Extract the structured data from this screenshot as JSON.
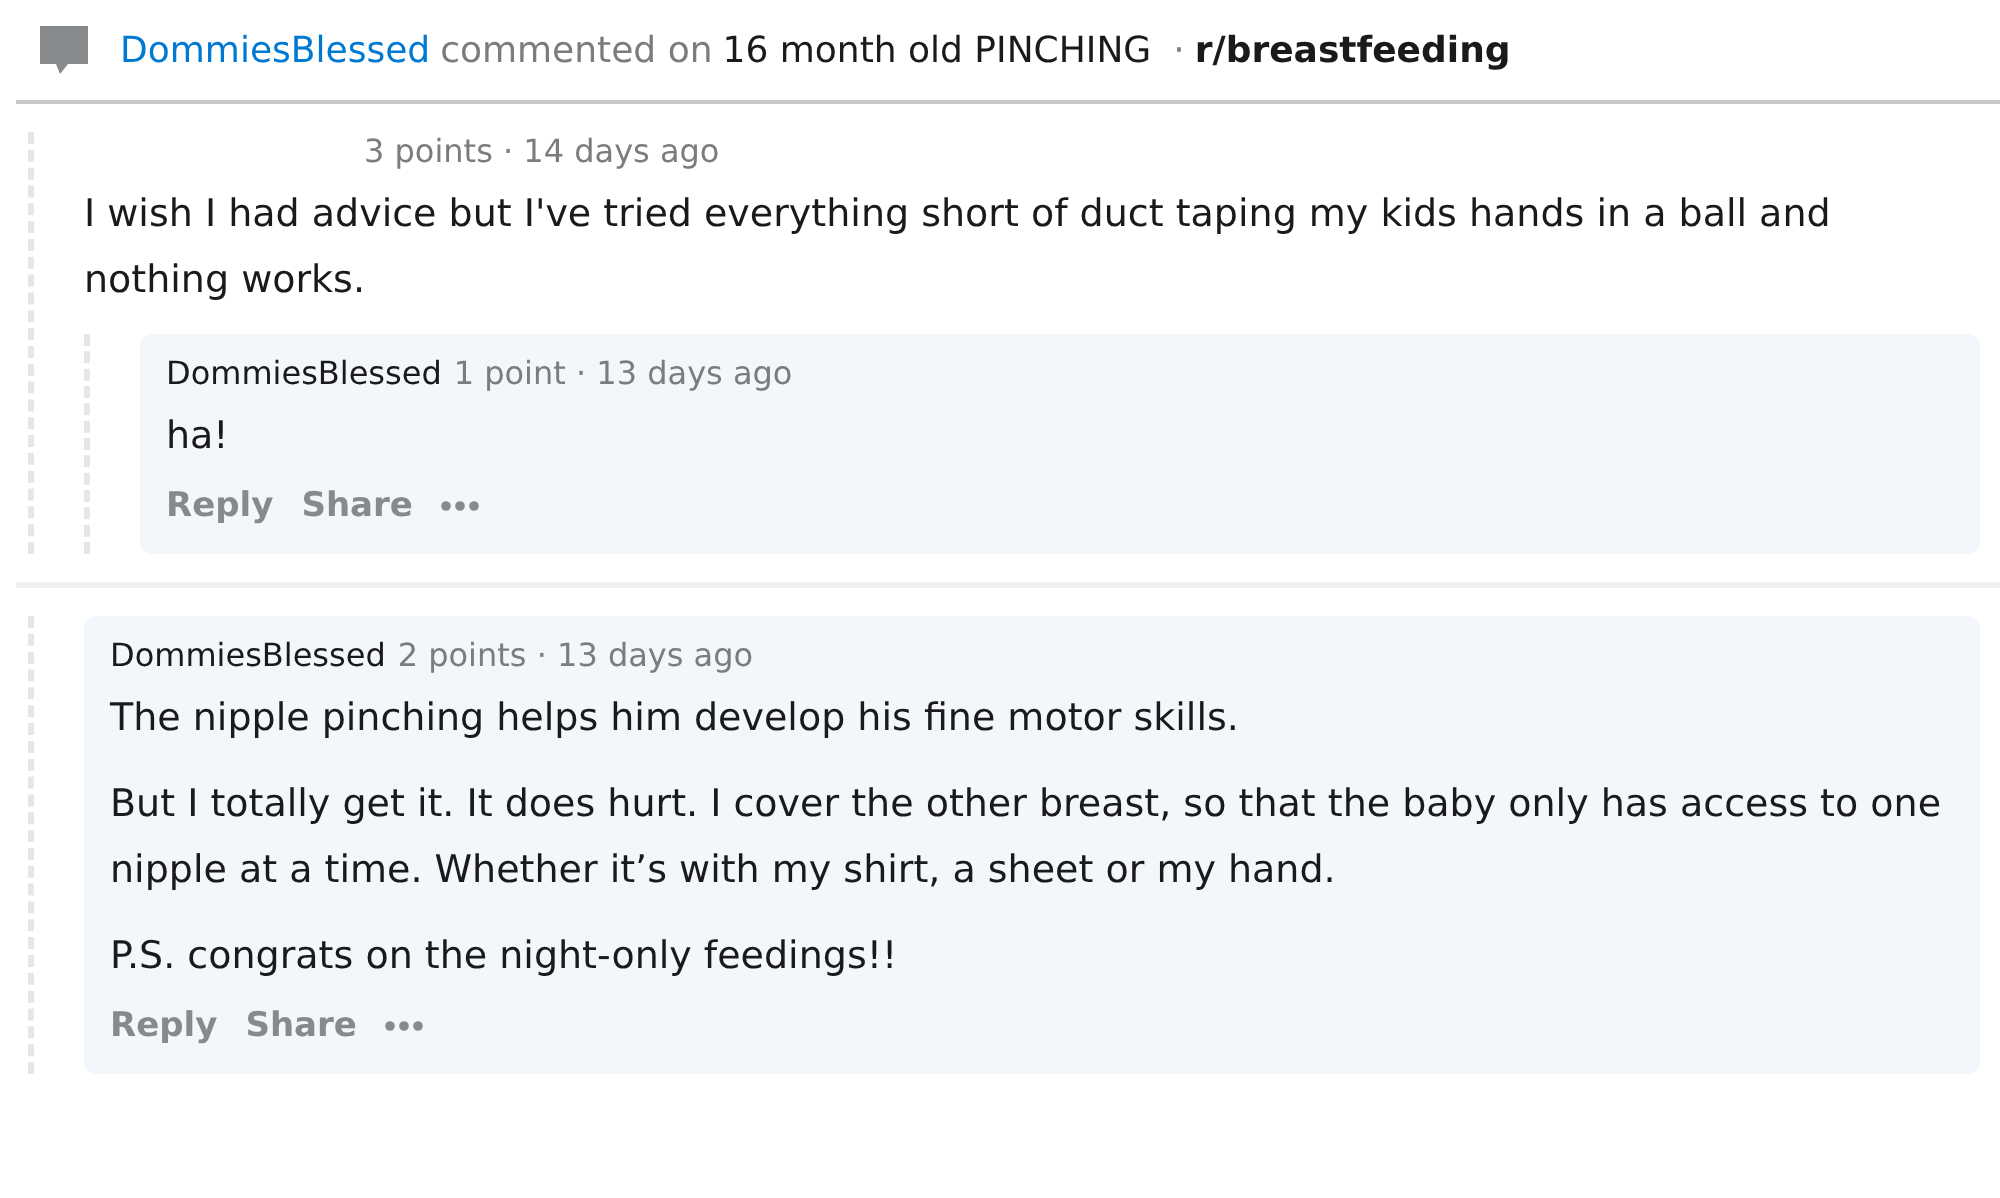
{
  "header": {
    "author": "DommiesBlessed",
    "action": "commented on",
    "post_title": "16 month old PINCHING",
    "separator": "·",
    "subreddit": "r/breastfeeding"
  },
  "threads": [
    {
      "comment": {
        "meta": "3 points · 14 days ago",
        "paragraphs": [
          "I wish I had advice but I've tried everything short of duct taping my kids hands in a ball and nothing works."
        ],
        "highlighted": false
      },
      "replies": [
        {
          "author": "DommiesBlessed",
          "meta": "1 point · 13 days ago",
          "paragraphs": [
            "ha!"
          ],
          "highlighted": true,
          "actions": [
            "Reply",
            "Share"
          ]
        }
      ]
    },
    {
      "comment": {
        "author": "DommiesBlessed",
        "meta": "2 points · 13 days ago",
        "paragraphs": [
          "The nipple pinching helps him develop his fine motor skills.",
          "But I totally get it. It does hurt. I cover the other breast, so that the baby only has access to one nipple at a time. Whether it’s with my shirt, a sheet or my hand.",
          "P.S. congrats on the night-only feedings!!"
        ],
        "highlighted": true,
        "actions": [
          "Reply",
          "Share"
        ]
      }
    }
  ]
}
